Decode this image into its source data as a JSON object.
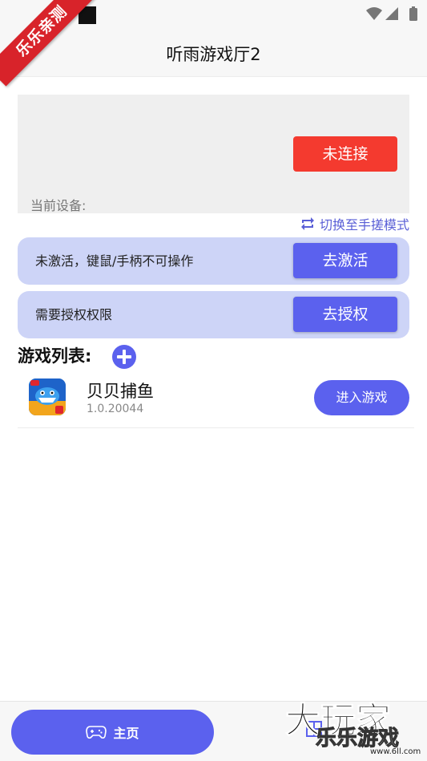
{
  "ribbon": {
    "text": "乐乐亲测"
  },
  "header": {
    "title": "听雨游戏厅2"
  },
  "device": {
    "connect_label": "未连接",
    "current_device_label": "当前设备:"
  },
  "switch_mode": {
    "label": "切换至手搓模式",
    "icon": "swap-icon"
  },
  "cards": [
    {
      "text": "未激活，键鼠/手柄不可操作",
      "button": "去激活"
    },
    {
      "text": "需要授权权限",
      "button": "去授权"
    }
  ],
  "game_list": {
    "title": "游戏列表:",
    "items": [
      {
        "name": "贝贝捕鱼",
        "version": "1.0.20044",
        "button": "进入游戏"
      }
    ]
  },
  "bottom_nav": {
    "home_label": "主页",
    "home_icon": "gamepad-icon"
  },
  "watermark": {
    "main": "大玩家",
    "sub": "乐乐游戏",
    "url": "www.6ll.com"
  },
  "colors": {
    "accent": "#5b61ee",
    "danger": "#f43a2f",
    "card_bg": "#cdd4f7"
  }
}
